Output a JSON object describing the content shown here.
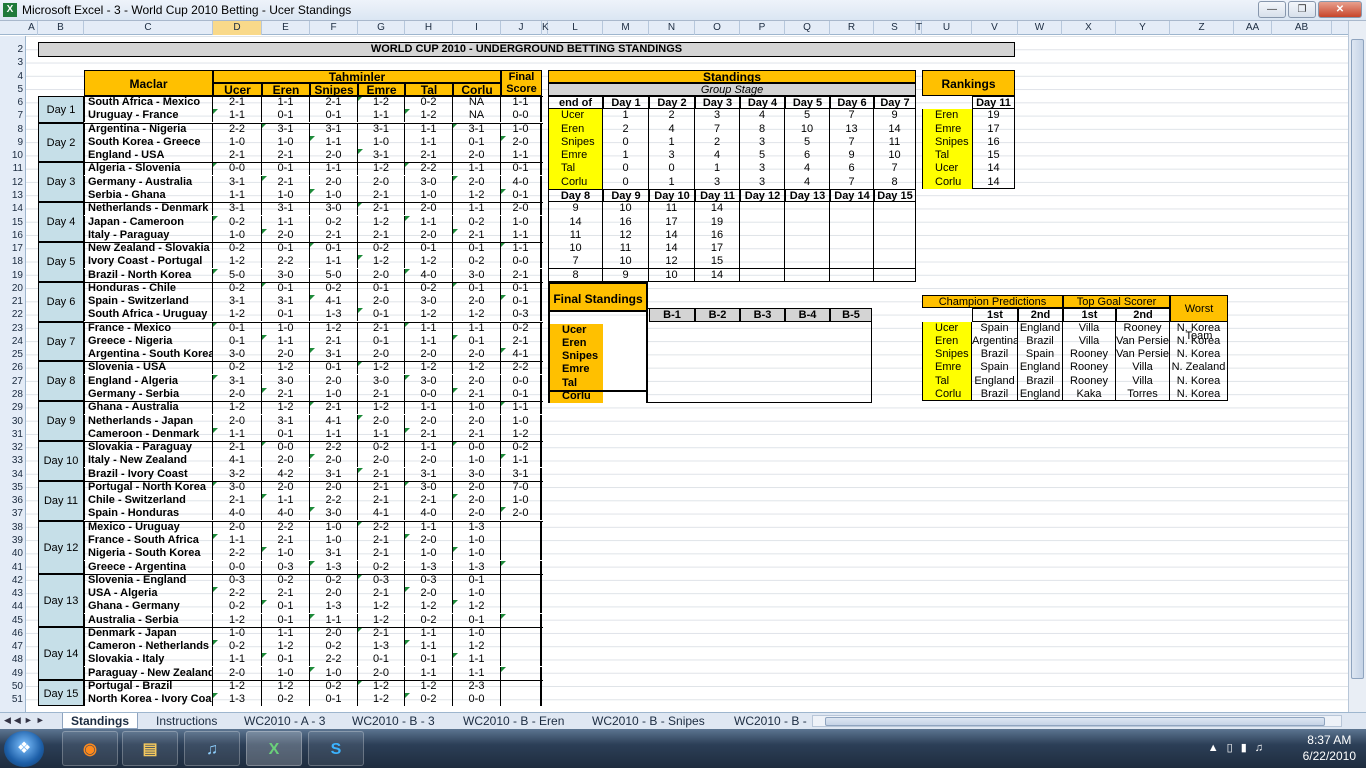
{
  "window": {
    "title": "Microsoft Excel - 3 - World Cup 2010 Betting - Ucer Standings",
    "icon": "excel-icon"
  },
  "columns": [
    "A",
    "B",
    "C",
    "D",
    "E",
    "F",
    "G",
    "H",
    "I",
    "J",
    "K",
    "L",
    "M",
    "N",
    "O",
    "P",
    "Q",
    "R",
    "S",
    "T",
    "U",
    "V",
    "W",
    "X",
    "Y",
    "Z",
    "AA",
    "AB"
  ],
  "rows": [
    "2",
    "3",
    "4",
    "5",
    "6",
    "7",
    "8",
    "9",
    "10",
    "11",
    "12",
    "13",
    "14",
    "15",
    "16",
    "17",
    "18",
    "19",
    "20",
    "21",
    "22",
    "23",
    "24",
    "25",
    "26",
    "27",
    "28",
    "29",
    "30",
    "31",
    "32",
    "33",
    "34",
    "35",
    "36",
    "37",
    "38",
    "39",
    "40",
    "41",
    "42",
    "43",
    "44",
    "45",
    "46",
    "47",
    "48",
    "49",
    "50",
    "51"
  ],
  "banner": "WORLD CUP 2010 - UNDERGROUND BETTING STANDINGS",
  "main": {
    "maclar": "Maclar",
    "tahminler": "Tahminler",
    "final_score_1": "Final",
    "final_score_2": "Score",
    "players": [
      "Ucer",
      "Eren",
      "Snipes",
      "Emre",
      "Tal",
      "Corlu"
    ],
    "days": [
      "Day 1",
      "Day 2",
      "Day 3",
      "Day 4",
      "Day 5",
      "Day 6",
      "Day 7",
      "Day 8",
      "Day 9",
      "Day 10",
      "Day 11",
      "Day 12",
      "Day 13",
      "Day 14",
      "Day 15"
    ],
    "matches": [
      [
        "South Africa - Mexico",
        "2-1",
        "1-1",
        "2-1",
        "1-2",
        "0-2",
        "NA",
        "1-1"
      ],
      [
        "Uruguay - France",
        "1-1",
        "0-1",
        "0-1",
        "1-1",
        "1-2",
        "NA",
        "0-0"
      ],
      [
        "Argentina - Nigeria",
        "2-2",
        "3-1",
        "3-1",
        "3-1",
        "1-1",
        "3-1",
        "1-0"
      ],
      [
        "South Korea - Greece",
        "1-0",
        "1-0",
        "1-1",
        "1-0",
        "1-1",
        "0-1",
        "2-0"
      ],
      [
        "England - USA",
        "2-1",
        "2-1",
        "2-0",
        "3-1",
        "2-1",
        "2-0",
        "1-1"
      ],
      [
        "Algeria - Slovenia",
        "0-0",
        "0-1",
        "1-1",
        "1-2",
        "2-2",
        "1-1",
        "0-1"
      ],
      [
        "Germany - Australia",
        "3-1",
        "2-1",
        "2-0",
        "2-0",
        "3-0",
        "2-0",
        "4-0"
      ],
      [
        "Serbia - Ghana",
        "1-1",
        "1-0",
        "1-0",
        "2-1",
        "1-0",
        "1-2",
        "0-1"
      ],
      [
        "Netherlands - Denmark",
        "3-1",
        "3-1",
        "3-0",
        "2-1",
        "2-0",
        "1-1",
        "2-0"
      ],
      [
        "Japan - Cameroon",
        "0-2",
        "1-1",
        "0-2",
        "1-2",
        "1-1",
        "0-2",
        "1-0"
      ],
      [
        "Italy - Paraguay",
        "1-0",
        "2-0",
        "2-1",
        "2-1",
        "2-0",
        "2-1",
        "1-1"
      ],
      [
        "New Zealand - Slovakia",
        "0-2",
        "0-1",
        "0-1",
        "0-2",
        "0-1",
        "0-1",
        "1-1"
      ],
      [
        "Ivory Coast - Portugal",
        "1-2",
        "2-2",
        "1-1",
        "1-2",
        "1-2",
        "0-2",
        "0-0"
      ],
      [
        "Brazil - North Korea",
        "5-0",
        "3-0",
        "5-0",
        "2-0",
        "4-0",
        "3-0",
        "2-1"
      ],
      [
        "Honduras - Chile",
        "0-2",
        "0-1",
        "0-2",
        "0-1",
        "0-2",
        "0-1",
        "0-1"
      ],
      [
        "Spain - Switzerland",
        "3-1",
        "3-1",
        "4-1",
        "2-0",
        "3-0",
        "2-0",
        "0-1"
      ],
      [
        "South Africa - Uruguay",
        "1-2",
        "0-1",
        "1-3",
        "0-1",
        "1-2",
        "1-2",
        "0-3"
      ],
      [
        "France - Mexico",
        "0-1",
        "1-0",
        "1-2",
        "2-1",
        "1-1",
        "1-1",
        "0-2"
      ],
      [
        "Greece - Nigeria",
        "0-1",
        "1-1",
        "2-1",
        "0-1",
        "1-1",
        "0-1",
        "2-1"
      ],
      [
        "Argentina - South Korea",
        "3-0",
        "2-0",
        "3-1",
        "2-0",
        "2-0",
        "2-0",
        "4-1"
      ],
      [
        "Slovenia - USA",
        "0-2",
        "1-2",
        "0-1",
        "1-2",
        "1-2",
        "1-2",
        "2-2"
      ],
      [
        "England - Algeria",
        "3-1",
        "3-0",
        "2-0",
        "3-0",
        "3-0",
        "2-0",
        "0-0"
      ],
      [
        "Germany - Serbia",
        "2-0",
        "2-1",
        "1-0",
        "2-1",
        "0-0",
        "2-1",
        "0-1"
      ],
      [
        "Ghana - Australia",
        "1-2",
        "1-2",
        "2-1",
        "1-2",
        "1-1",
        "1-0",
        "1-1"
      ],
      [
        "Netherlands - Japan",
        "2-0",
        "3-1",
        "4-1",
        "2-0",
        "2-0",
        "2-0",
        "1-0"
      ],
      [
        "Cameroon - Denmark",
        "1-1",
        "0-1",
        "1-1",
        "1-1",
        "2-1",
        "2-1",
        "1-2"
      ],
      [
        "Slovakia - Paraguay",
        "2-1",
        "0-0",
        "2-2",
        "0-2",
        "1-1",
        "0-0",
        "0-2"
      ],
      [
        "Italy - New Zealand",
        "4-1",
        "2-0",
        "2-0",
        "2-0",
        "2-0",
        "1-0",
        "1-1"
      ],
      [
        "Brazil - Ivory Coast",
        "3-2",
        "4-2",
        "3-1",
        "2-1",
        "3-1",
        "3-0",
        "3-1"
      ],
      [
        "Portugal - North Korea",
        "3-0",
        "2-0",
        "2-0",
        "2-1",
        "3-0",
        "2-0",
        "7-0"
      ],
      [
        "Chile - Switzerland",
        "2-1",
        "1-1",
        "2-2",
        "2-1",
        "2-1",
        "2-0",
        "1-0"
      ],
      [
        "Spain - Honduras",
        "4-0",
        "4-0",
        "3-0",
        "4-1",
        "4-0",
        "2-0",
        "2-0"
      ],
      [
        "Mexico - Uruguay",
        "2-0",
        "2-2",
        "1-0",
        "2-2",
        "1-1",
        "1-3",
        ""
      ],
      [
        "France - South Africa",
        "1-1",
        "2-1",
        "1-0",
        "2-1",
        "2-0",
        "1-0",
        ""
      ],
      [
        "Nigeria - South Korea",
        "2-2",
        "1-0",
        "3-1",
        "2-1",
        "1-0",
        "1-0",
        ""
      ],
      [
        "Greece - Argentina",
        "0-0",
        "0-3",
        "1-3",
        "0-2",
        "1-3",
        "1-3",
        ""
      ],
      [
        "Slovenia - England",
        "0-3",
        "0-2",
        "0-2",
        "0-3",
        "0-3",
        "0-1",
        ""
      ],
      [
        "USA - Algeria",
        "2-2",
        "2-1",
        "2-0",
        "2-1",
        "2-0",
        "1-0",
        ""
      ],
      [
        "Ghana - Germany",
        "0-2",
        "0-1",
        "1-3",
        "1-2",
        "1-2",
        "1-2",
        ""
      ],
      [
        "Australia - Serbia",
        "1-2",
        "0-1",
        "1-1",
        "1-2",
        "0-2",
        "0-1",
        ""
      ],
      [
        "Denmark - Japan",
        "1-0",
        "1-1",
        "2-0",
        "2-1",
        "1-1",
        "1-0",
        ""
      ],
      [
        "Cameron - Netherlands",
        "0-2",
        "1-2",
        "0-2",
        "1-3",
        "1-1",
        "1-2",
        ""
      ],
      [
        "Slovakia - Italy",
        "1-1",
        "0-1",
        "2-2",
        "0-1",
        "0-1",
        "1-1",
        ""
      ],
      [
        "Paraguay - New Zealand",
        "2-0",
        "1-0",
        "1-0",
        "2-0",
        "1-1",
        "1-1",
        ""
      ],
      [
        "Portugal - Brazil",
        "1-2",
        "1-2",
        "0-2",
        "1-2",
        "1-2",
        "2-3",
        ""
      ],
      [
        "North Korea - Ivory Coast",
        "1-3",
        "0-2",
        "0-1",
        "1-2",
        "0-2",
        "0-0",
        ""
      ]
    ]
  },
  "standings": {
    "title": "Standings",
    "subtitle": "Group Stage",
    "end_of": "end of",
    "days_a": [
      "Day 1",
      "Day 2",
      "Day 3",
      "Day 4",
      "Day 5",
      "Day 6",
      "Day 7"
    ],
    "days_b": [
      "Day 8",
      "Day 9",
      "Day 10",
      "Day 11",
      "Day 12",
      "Day 13",
      "Day 14",
      "Day 15"
    ],
    "players": [
      "Ucer",
      "Eren",
      "Snipes",
      "Emre",
      "Tal",
      "Corlu"
    ],
    "scores_a": [
      [
        "1",
        "2",
        "3",
        "4",
        "5",
        "7",
        "9"
      ],
      [
        "2",
        "4",
        "7",
        "8",
        "10",
        "13",
        "14"
      ],
      [
        "0",
        "1",
        "2",
        "3",
        "5",
        "7",
        "11"
      ],
      [
        "1",
        "3",
        "4",
        "5",
        "6",
        "9",
        "10"
      ],
      [
        "0",
        "0",
        "1",
        "3",
        "4",
        "6",
        "7"
      ],
      [
        "0",
        "1",
        "3",
        "3",
        "4",
        "7",
        "8"
      ]
    ],
    "scores_b": [
      [
        "9",
        "10",
        "11",
        "14"
      ],
      [
        "14",
        "16",
        "17",
        "19"
      ],
      [
        "11",
        "12",
        "14",
        "16"
      ],
      [
        "10",
        "11",
        "14",
        "17"
      ],
      [
        "7",
        "10",
        "12",
        "15"
      ],
      [
        "8",
        "9",
        "10",
        "14"
      ]
    ]
  },
  "rankings": {
    "title": "Rankings",
    "day": "Day 11",
    "names": [
      "Eren",
      "Emre",
      "Snipes",
      "Tal",
      "Ucer",
      "Corlu"
    ],
    "scores": [
      "19",
      "17",
      "16",
      "15",
      "14",
      "14"
    ]
  },
  "final_standings": {
    "title": "Final Standings",
    "cols": [
      "B-1",
      "B-2",
      "B-3",
      "B-4",
      "B-5"
    ],
    "names": [
      "Ucer",
      "Eren",
      "Snipes",
      "Emre",
      "Tal",
      "Corlu"
    ]
  },
  "predictions": {
    "champ_title": "Champion Predictions",
    "scorer_title": "Top Goal Scorer",
    "worst_title": "Worst Team",
    "first": "1st",
    "second": "2nd",
    "rows": [
      [
        "Ucer",
        "Spain",
        "England",
        "Villa",
        "Rooney",
        "N. Korea"
      ],
      [
        "Eren",
        "Argentina",
        "Brazil",
        "Villa",
        "Van Persie",
        "N. Korea"
      ],
      [
        "Snipes",
        "Brazil",
        "Spain",
        "Rooney",
        "Van Persie",
        "N. Korea"
      ],
      [
        "Emre",
        "Spain",
        "England",
        "Rooney",
        "Villa",
        "N. Zealand"
      ],
      [
        "Tal",
        "England",
        "Brazil",
        "Rooney",
        "Villa",
        "N. Korea"
      ],
      [
        "Corlu",
        "Brazil",
        "England",
        "Kaka",
        "Torres",
        "N. Korea"
      ]
    ]
  },
  "tabs": [
    "Standings",
    "Instructions",
    "WC2010 - A - 3",
    "WC2010 - B - 3",
    "WC2010 - B - Eren",
    "WC2010 - B - Snipes",
    "WC2010 - B -"
  ],
  "taskbar": {
    "time": "8:37 AM",
    "date": "6/22/2010"
  }
}
